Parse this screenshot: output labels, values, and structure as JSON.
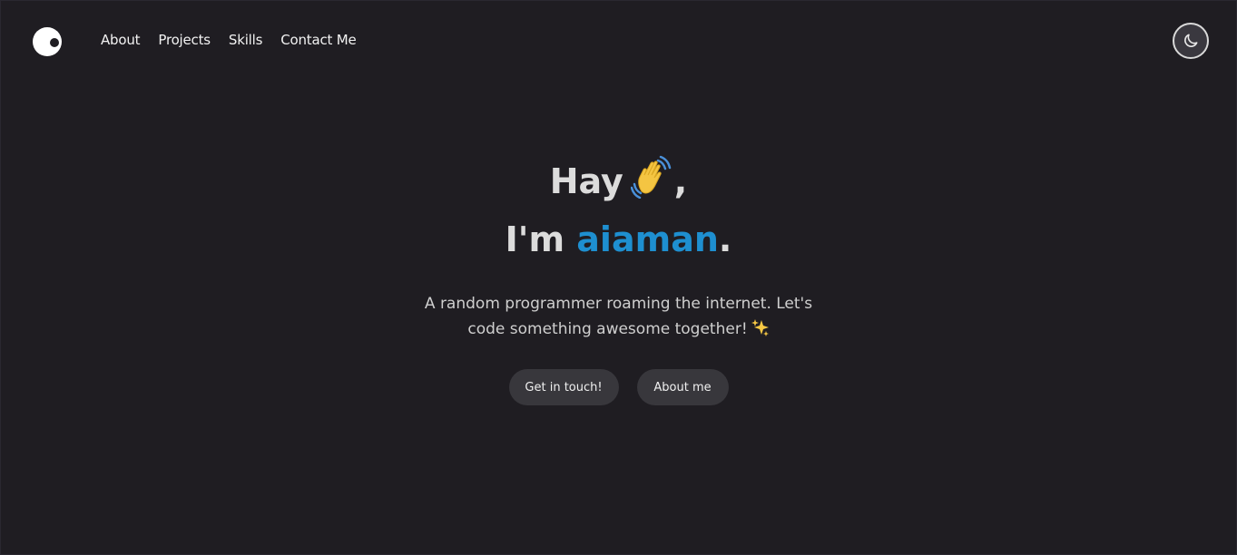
{
  "nav": {
    "logo_icon": "eye-logo-icon",
    "items": [
      {
        "label": "About"
      },
      {
        "label": "Projects"
      },
      {
        "label": "Skills"
      },
      {
        "label": "Contact Me"
      }
    ],
    "theme_toggle_icon": "moon-icon"
  },
  "hero": {
    "greeting": "Hay",
    "greeting_icon": "waving-hand-icon",
    "greeting_suffix": ",",
    "intro_prefix": "I'm",
    "name": "aiaman",
    "name_suffix": ".",
    "tagline_line1": "A random programmer roaming the internet. Let's",
    "tagline_line2": "code something awesome together!",
    "tagline_icon": "sparkles-icon"
  },
  "buttons": {
    "primary_label": "Get in touch!",
    "secondary_label": "About me"
  },
  "colors": {
    "background": "#1f1d22",
    "accent": "#1e8fd0",
    "button_bg": "#38373c",
    "text": "#dcdcdc"
  }
}
